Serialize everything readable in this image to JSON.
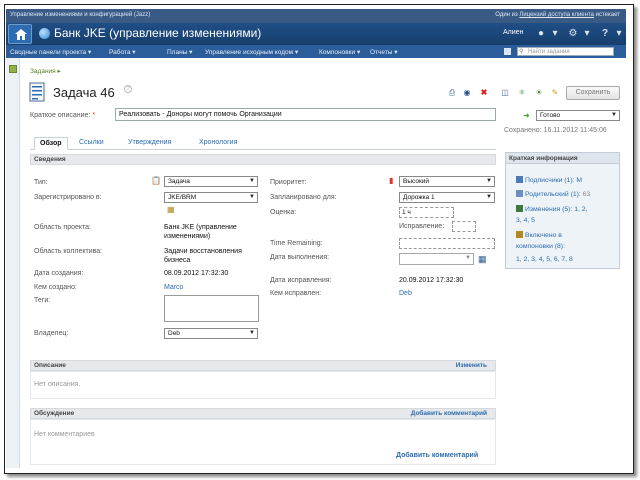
{
  "topbar": {
    "left_text": "Управление изменениями и конфигурацией (Jazz)",
    "right_prefix": "Один из ",
    "right_link": "Лицензий доступа клиента",
    "right_suffix": " истекает"
  },
  "header": {
    "project_title": "Банк JKE (управление изменениями)",
    "user_name": "Алиен"
  },
  "nav": {
    "items": [
      "Сводные панели проекта ▾",
      "Работа ▾",
      "Планы ▾",
      "Управление исходным кодом ▾",
      "Компоновки ▾",
      "Отчеты ▾"
    ],
    "search_placeholder": "Найти задания"
  },
  "breadcrumb": "Задания ▸",
  "work_item": {
    "title": "Задача 46",
    "save_label": "Сохранить",
    "summary_label": "Краткое описание:",
    "summary_required": "*",
    "summary_value": "Реализовать - Доноры могут помочь Организации",
    "state_value": "Готово",
    "saved_text": "Сохранено: 16.11.2012 11:45:06"
  },
  "tabs": [
    "Обзор",
    "Ссылки",
    "Утверждения",
    "Хронология"
  ],
  "overview": {
    "section_title": "Сведения",
    "left": {
      "type_label": "Тип:",
      "type_value": "Задача",
      "filed_label": "Зарегистрировано в:",
      "filed_value": "JKE/BRM",
      "project_area_label": "Область проекта:",
      "project_area_value_1": "Банк JKE (управление",
      "project_area_value_2": "изменениями)",
      "team_area_label": "Область коллектива:",
      "team_area_value_1": "Задачи восстановления",
      "team_area_value_2": "бизнеса",
      "created_label": "Дата создания:",
      "created_value": "08.09.2012 17:32:30",
      "creator_label": "Кем создано:",
      "creator_value": "Marco",
      "tags_label": "Теги:",
      "owner_label": "Владелец:",
      "owner_value": "Deb"
    },
    "right": {
      "priority_label": "Приоритет:",
      "priority_value": "Высокий",
      "planned_label": "Запланировано для:",
      "planned_value": "Дорожка 1",
      "estimate_label": "Оценка:",
      "estimate_value": "1 ч",
      "correction_label": "Исправление:",
      "remaining_label": "Time Remaining:",
      "due_label": "Дата выполнения:",
      "resolved_date_label": "Дата исправления:",
      "resolved_date_value": "20.09.2012 17:32:30",
      "resolved_by_label": "Кем исправлен:",
      "resolved_by_value": "Deb"
    }
  },
  "description": {
    "title": "Описание",
    "action": "Изменить",
    "empty": "Нет описания."
  },
  "discussion": {
    "title": "Обсуждение",
    "action": "Добавить комментарий",
    "empty": "Нет комментариев",
    "bottom_action": "Добавить комментарий"
  },
  "quick_info": {
    "title": "Краткая информация",
    "subscribers": "Подписчики (1): M",
    "parent_prefix": "Родительский (1): ",
    "parent_value": "63",
    "changes_prefix": "Изменения (5): ",
    "changes_links": [
      "1,",
      "2,",
      "3,",
      "4,",
      "5"
    ],
    "included_line1": "Включено в",
    "included_line2": "компоновки (8):",
    "builds": [
      "1,",
      "2,",
      "3,",
      "4,",
      "5,",
      "6,",
      "7,",
      "8"
    ]
  },
  "colors": {
    "header_bg": "#1f4f86",
    "nav_bg": "#2a5d99",
    "link": "#2b6cb0",
    "priority_red": "#d33"
  }
}
